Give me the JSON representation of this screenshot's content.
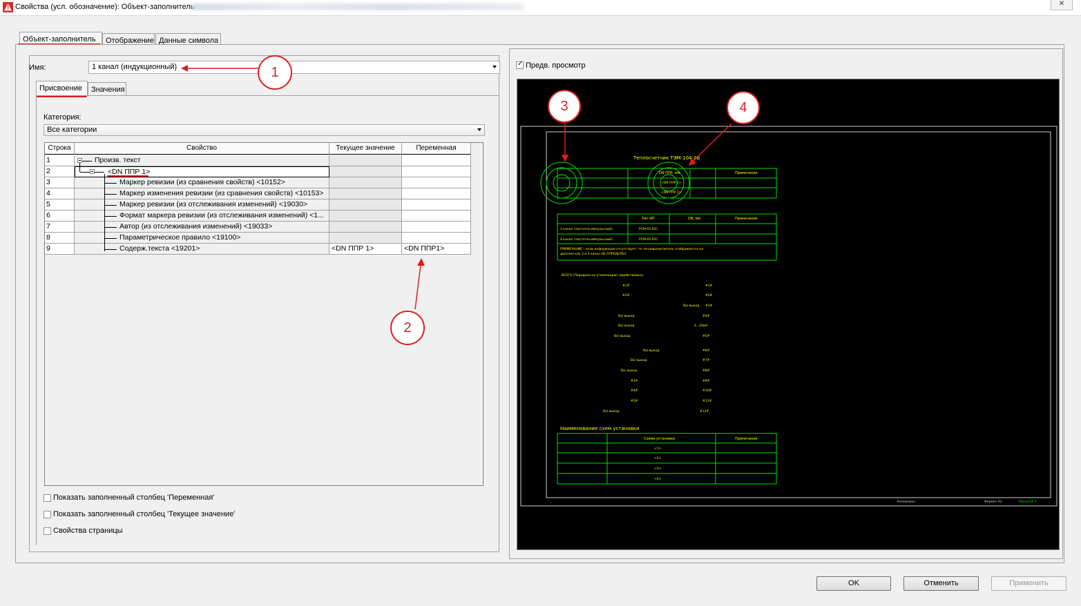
{
  "window": {
    "title": "Свойства (усл. обозначение): Объект-заполнитель",
    "close_glyph": "✕"
  },
  "tabs": [
    {
      "label": "Объект-заполнитель",
      "active": true
    },
    {
      "label": "Отображение",
      "active": false
    },
    {
      "label": "Данные символа",
      "active": false
    }
  ],
  "name_field": {
    "label": "Имя:",
    "value": "1 канал (индукционный)"
  },
  "subtabs": [
    {
      "label": "Присвоение",
      "active": true
    },
    {
      "label": "Значения",
      "active": false
    }
  ],
  "category": {
    "label": "Категория:",
    "value": "Все категории"
  },
  "grid": {
    "columns": [
      "Строка",
      "Свойство",
      "Текущее значение",
      "Переменная"
    ],
    "rows": [
      {
        "num": "1",
        "prop": "Произв. текст",
        "current": "",
        "variable": ""
      },
      {
        "num": "2",
        "prop": "<DN ППР 1>",
        "current": "",
        "variable": ""
      },
      {
        "num": "3",
        "prop": "Маркер ревизии (из сравнения свойств) <10152>",
        "current": "",
        "variable": ""
      },
      {
        "num": "4",
        "prop": "Маркер изменения ревизии (из сравнения свойств) <10153>",
        "current": "",
        "variable": ""
      },
      {
        "num": "5",
        "prop": "Маркер ревизии (из отслеживания изменений) <19030>",
        "current": "",
        "variable": ""
      },
      {
        "num": "6",
        "prop": "Формат маркера ревизии (из отслеживания изменений) <1...",
        "current": "",
        "variable": ""
      },
      {
        "num": "7",
        "prop": "Автор (из отслеживания изменений) <19033>",
        "current": "",
        "variable": ""
      },
      {
        "num": "8",
        "prop": "Параметрическое правило <19100>",
        "current": "",
        "variable": ""
      },
      {
        "num": "9",
        "prop": "Содерж.текста <19201>",
        "current": "<DN ППР 1>",
        "variable": "<DN ППР1>"
      }
    ]
  },
  "checkboxes": [
    {
      "label": "Показать заполненный столбец 'Переменная'",
      "checked": false
    },
    {
      "label": "Показать заполненный столбец 'Текущее значение'",
      "checked": false
    },
    {
      "label": "Свойства страницы",
      "checked": false
    }
  ],
  "preview": {
    "checkbox_label": "Предв. просмотр",
    "checked": true,
    "drawing_title": "Теплосчетчик ТЭМ-104-2В",
    "table1_headers": [
      "DN ППР, мм",
      "Примечание"
    ],
    "table1_cells": [
      "<DN ППР 1>",
      "<DN ППР 2>"
    ],
    "table2_headers": [
      "Тип ИП",
      "DN, мм",
      "Примечание"
    ],
    "table2_rows": [
      [
        "3 канал (частотно-импульсный)",
        "РСМ-05.05С"
      ],
      [
        "4 канал (частотно-импульсный)",
        "РСМ-05.05С"
      ]
    ],
    "table2_note": "ПРИМЕЧАНИЕ – если информация отсутствует, то тепловычислитель отображается на",
    "table2_note2": "дисплее как 3 и 4 канал НЕ ОПРЕДЕЛЕН",
    "list_title": "ВСЕГО (Передано на утилизацию) задействовано",
    "left_labels": [
      "#1#",
      "#2#",
      "Вх/ выход",
      "Вх/ выход",
      "Вх/ выход",
      "Вх/ выход",
      "Вх/ выход",
      "Вх/ выход",
      "#3#",
      "#4#",
      "#5#",
      "Вх/ выход"
    ],
    "right_labels": [
      "#1#",
      "#2#",
      "#3#",
      "#4#",
      "4...20мА",
      "#5#",
      "#6#",
      "#7#",
      "#8#",
      "#9#",
      "#10#",
      "#11#",
      "#12#"
    ],
    "right_prefix": "Вх/ выход",
    "section_title": "Наименование схем установки",
    "table3_headers": [
      "Схема установки",
      "Примечание"
    ],
    "table3_cells": [
      "<1>",
      "<2>",
      "<3>",
      "<4>"
    ],
    "footer": [
      "Копировал",
      "Формат А3",
      "Масштаб 1"
    ]
  },
  "callouts": [
    "1",
    "2",
    "3",
    "4"
  ],
  "buttons": {
    "ok": "OK",
    "cancel": "Отменить",
    "apply": "Применить"
  },
  "colors": {
    "annotation": "#d91f1f",
    "drawing": "#00e000",
    "drawing_text": "#ffff00"
  }
}
